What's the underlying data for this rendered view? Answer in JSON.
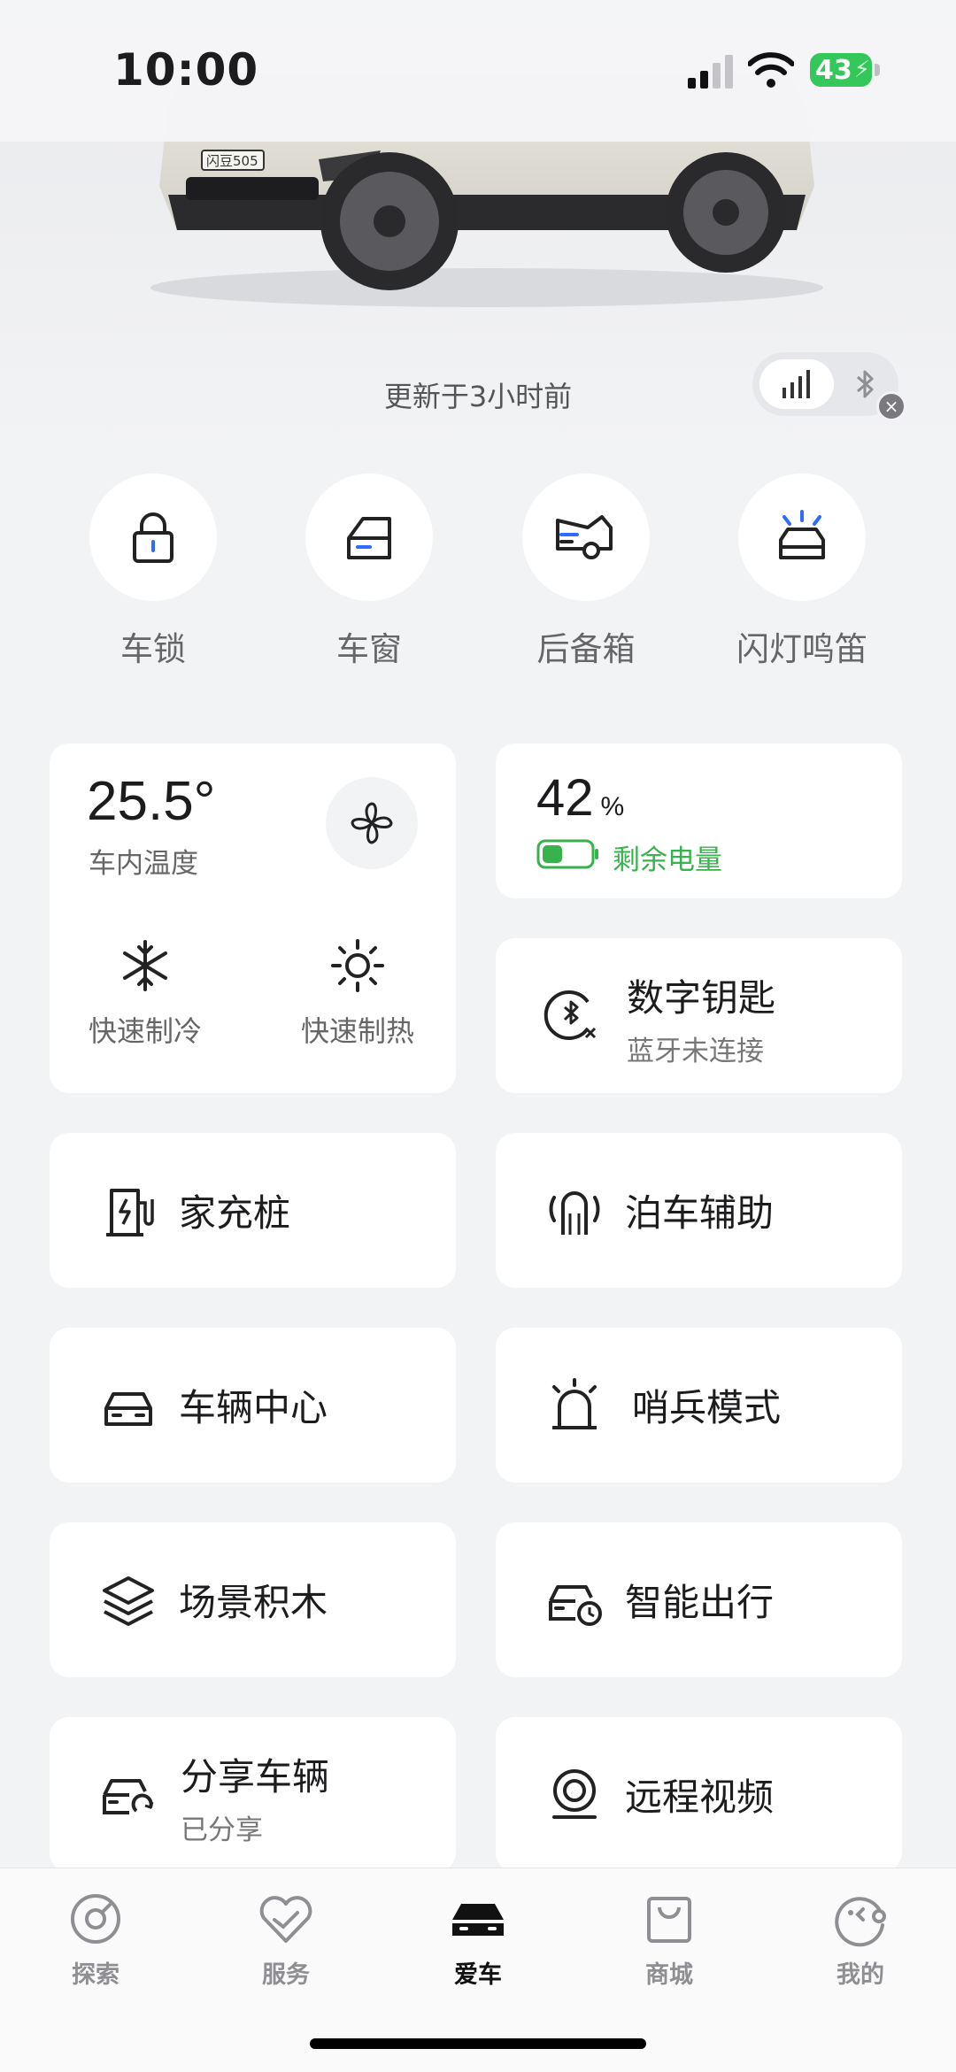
{
  "status_bar": {
    "time": "10:00",
    "battery": "43"
  },
  "hero": {
    "plate_text": "闪豆505",
    "updated_text": "更新于3小时前",
    "connection": {
      "active": "signal",
      "close": "×"
    }
  },
  "quick_actions": [
    {
      "label": "车锁",
      "icon": "lock-icon"
    },
    {
      "label": "车窗",
      "icon": "window-icon"
    },
    {
      "label": "后备箱",
      "icon": "trunk-icon"
    },
    {
      "label": "闪灯鸣笛",
      "icon": "flash-horn-icon"
    }
  ],
  "climate": {
    "temperature": "25.5°",
    "temperature_label": "车内温度",
    "cool_label": "快速制冷",
    "heat_label": "快速制热"
  },
  "battery_card": {
    "value": "42",
    "unit": "%",
    "label": "剩余电量",
    "level": 0.42,
    "color": "#37b24d"
  },
  "digital_key": {
    "title": "数字钥匙",
    "status": "蓝牙未连接"
  },
  "cards": {
    "home_charger": "家充桩",
    "parking_assist": "泊车辅助",
    "vehicle_center": "车辆中心",
    "sentry_mode": "哨兵模式",
    "scene_blocks": "场景积木",
    "smart_travel": "智能出行",
    "share_vehicle": {
      "title": "分享车辆",
      "status": "已分享"
    },
    "remote_video": "远程视频"
  },
  "tab_bar": [
    {
      "label": "探索",
      "icon": "explore-icon"
    },
    {
      "label": "服务",
      "icon": "service-icon"
    },
    {
      "label": "爱车",
      "icon": "car-icon",
      "active": true
    },
    {
      "label": "商城",
      "icon": "shop-icon"
    },
    {
      "label": "我的",
      "icon": "profile-icon"
    }
  ],
  "colors": {
    "accent_blue": "#2f6bff",
    "green": "#37b24d",
    "background": "#f2f3f5"
  }
}
